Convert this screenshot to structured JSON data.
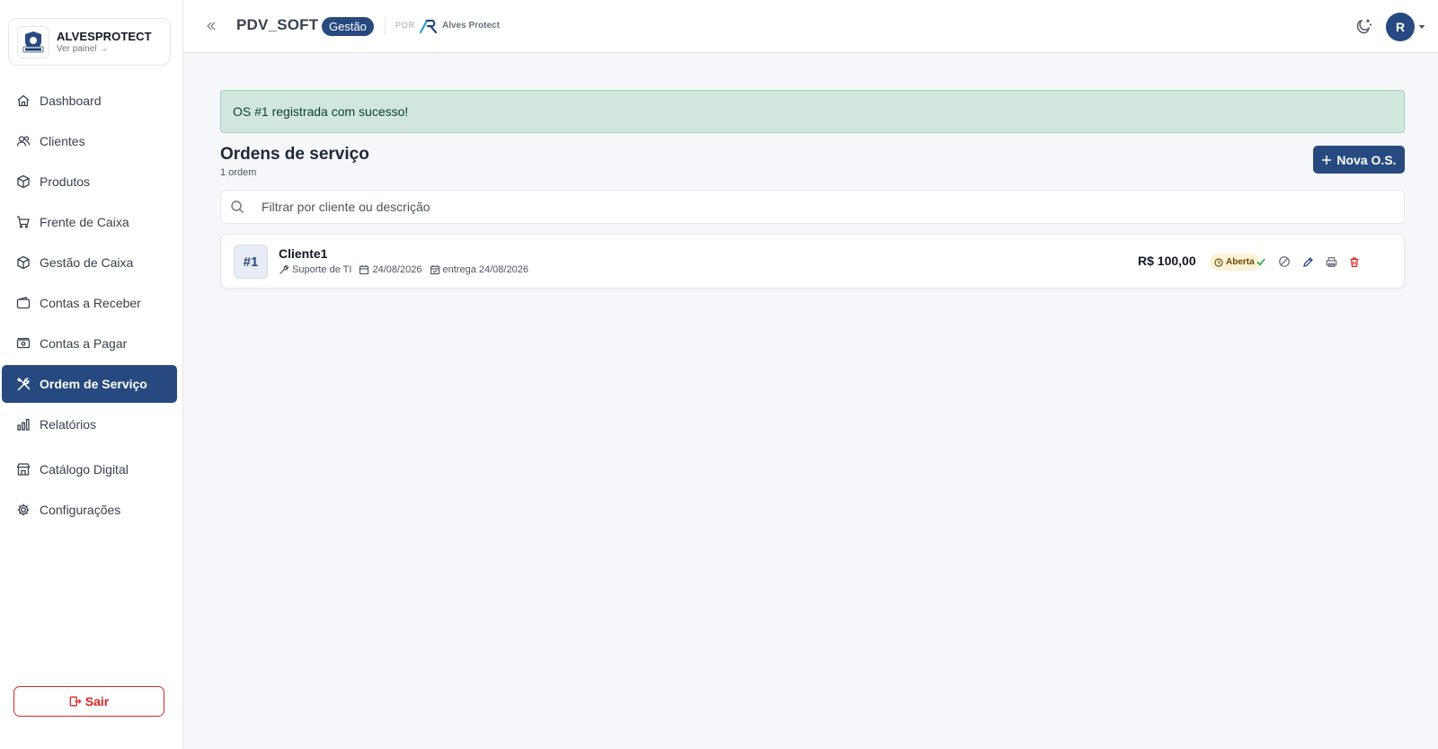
{
  "brand": {
    "name": "ALVESPROTECT",
    "sub": "Ver painel →"
  },
  "nav": {
    "items": [
      {
        "label": "Dashboard"
      },
      {
        "label": "Clientes"
      },
      {
        "label": "Produtos"
      },
      {
        "label": "Frente de Caixa"
      },
      {
        "label": "Gestão de Caixa"
      },
      {
        "label": "Contas a Receber"
      },
      {
        "label": "Contas a Pagar"
      },
      {
        "label": "Ordem de Serviço"
      },
      {
        "label": "Relatórios"
      },
      {
        "label": "Catálogo Digital"
      },
      {
        "label": "Configurações"
      }
    ],
    "active_index": 7,
    "logout_label": "Sair"
  },
  "header": {
    "app_title": "PDV_SOFT",
    "app_badge": "Gestão",
    "by_label": "POR",
    "partner_name": "Alves Protect",
    "avatar_initial": "R"
  },
  "main": {
    "alert": "OS #1 registrada com sucesso!",
    "title": "Ordens de serviço",
    "count": "1 ordem",
    "new_button": "Nova O.S.",
    "search_placeholder": "Filtrar por cliente ou descrição",
    "search_value": ""
  },
  "orders": [
    {
      "number": "#1",
      "client": "Cliente1",
      "service": "Suporte de TI",
      "date": "24/08/2026",
      "delivery": "entrega 24/08/2026",
      "price": "R$ 100,00",
      "status": "Aberta"
    }
  ],
  "colors": {
    "primary": "#264a80",
    "success_bg": "#d1e7dd",
    "danger": "#dc2626",
    "status_open_bg": "#fdf3d6"
  },
  "icons": {
    "nav": [
      "home-icon",
      "users-icon",
      "box-icon",
      "cart-icon",
      "box-icon",
      "wallet-icon",
      "banknote-icon",
      "tools-icon",
      "chart-icon",
      "store-icon",
      "gear-icon"
    ],
    "actions": [
      "check-icon",
      "cancel-icon",
      "edit-icon",
      "print-icon",
      "trash-icon"
    ]
  }
}
